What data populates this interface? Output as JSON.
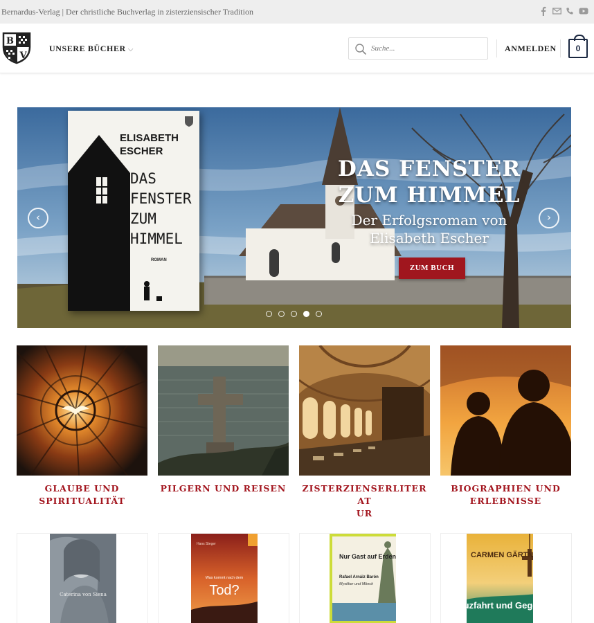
{
  "topbar": {
    "tagline": "Bernardus-Verlag | Der christliche Buchverlag in zisterziensischer Tradition",
    "social_icons": [
      "facebook-icon",
      "mail-icon",
      "phone-icon",
      "youtube-icon"
    ]
  },
  "header": {
    "logo_letters": [
      "B",
      "V"
    ],
    "nav_books": "UNSERE BÜCHER",
    "search_placeholder": "Suche...",
    "login": "ANMELDEN",
    "cart_count": "0"
  },
  "slider": {
    "book_author": "ELISABETH ESCHER",
    "book_title": "DAS FENSTER ZUM HIMMEL",
    "book_genre": "ROMAN",
    "headline": "DAS FENSTER ZUM HIMMEL",
    "subline": "Der Erfolgsroman von Elisabeth Escher",
    "cta": "ZUM BUCH",
    "slide_count": 5,
    "active_slide": 4
  },
  "categories": [
    {
      "label": "GLAUBE UND SPIRITUALITÄT"
    },
    {
      "label": "PILGERN UND REISEN"
    },
    {
      "label": "ZISTERZIENSERLITERATUR"
    },
    {
      "label": "BIOGRAPHIEN UND ERLEBNISSE"
    }
  ],
  "books": [
    {
      "cover_text": "Caterina von Siena"
    },
    {
      "cover_top": "Hans Steger",
      "cover_small": "Was kommt nach dem",
      "cover_text": "Tod?"
    },
    {
      "cover_top": "Nur Gast auf Erden",
      "cover_sub": "Rafael Arnáiz Barón",
      "cover_small": "Mystiker und Mönch"
    },
    {
      "cover_top": "CARMEN GÄRTNER",
      "cover_text": "Kreuzfahrt und Gegenwind"
    }
  ],
  "colors": {
    "accent": "#a3161f",
    "topbar_bg": "#eeeeee",
    "cart_border": "#1a2740"
  }
}
